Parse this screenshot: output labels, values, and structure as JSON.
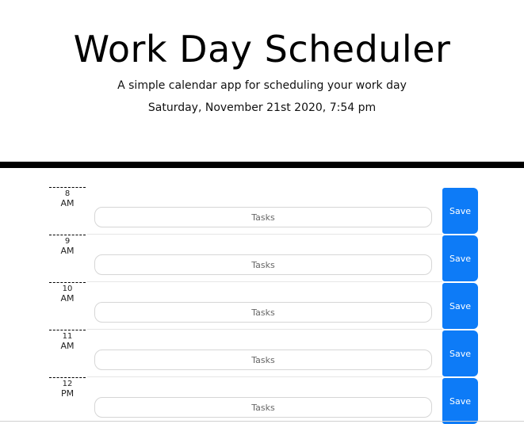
{
  "header": {
    "title": "Work Day Scheduler",
    "subtitle": "A simple calendar app for scheduling your work day",
    "current_day": "Saturday, November 21st 2020, 7:54 pm"
  },
  "timeblocks": [
    {
      "hour": "8",
      "period": "AM",
      "task_placeholder": "Tasks",
      "task_value": "",
      "save_label": "Save"
    },
    {
      "hour": "9",
      "period": "AM",
      "task_placeholder": "Tasks",
      "task_value": "",
      "save_label": "Save"
    },
    {
      "hour": "10",
      "period": "AM",
      "task_placeholder": "Tasks",
      "task_value": "",
      "save_label": "Save"
    },
    {
      "hour": "11",
      "period": "AM",
      "task_placeholder": "Tasks",
      "task_value": "",
      "save_label": "Save"
    },
    {
      "hour": "12",
      "period": "PM",
      "task_placeholder": "Tasks",
      "task_value": "",
      "save_label": "Save"
    }
  ],
  "colors": {
    "save_button": "#0d7bf7",
    "divider": "#000000",
    "background": "#ffffff"
  }
}
